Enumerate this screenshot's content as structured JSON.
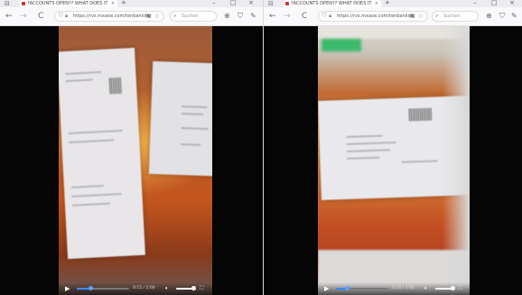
{
  "left": {
    "tab": {
      "title": "?ACCOUNTS OPEN?? WHAT DOES IT",
      "close": "×"
    },
    "tab_icon": "list-tabs-icon",
    "new_tab": "+",
    "window_controls": {
      "minimize": "–",
      "maximize": "□",
      "close": "×"
    },
    "nav": {
      "back": "←",
      "forward": "→",
      "reload": "C"
    },
    "url": "https://rvs.mxaoe.com/tenbanking",
    "search_placeholder": "Suchen",
    "player": {
      "time": "0:15 / 1:00"
    },
    "colors": {
      "progress": "#3a8cff"
    },
    "progress_fraction": 0.25
  },
  "right": {
    "tab": {
      "title": "?ACCOUNTS OPEN?? WHAT DOES IT",
      "close": "×"
    },
    "tab_icon": "list-tabs-icon",
    "new_tab": "+",
    "window_controls": {
      "minimize": "–",
      "maximize": "□",
      "close": "×"
    },
    "nav": {
      "back": "←",
      "forward": "→",
      "reload": "C"
    },
    "url": "https://rvs.mxaoe.com/tenbanking",
    "search_placeholder": "Suchen",
    "player": {
      "time": "0:16 / 1:00"
    },
    "colors": {
      "progress": "#3a8cff"
    },
    "progress_fraction": 0.2
  }
}
